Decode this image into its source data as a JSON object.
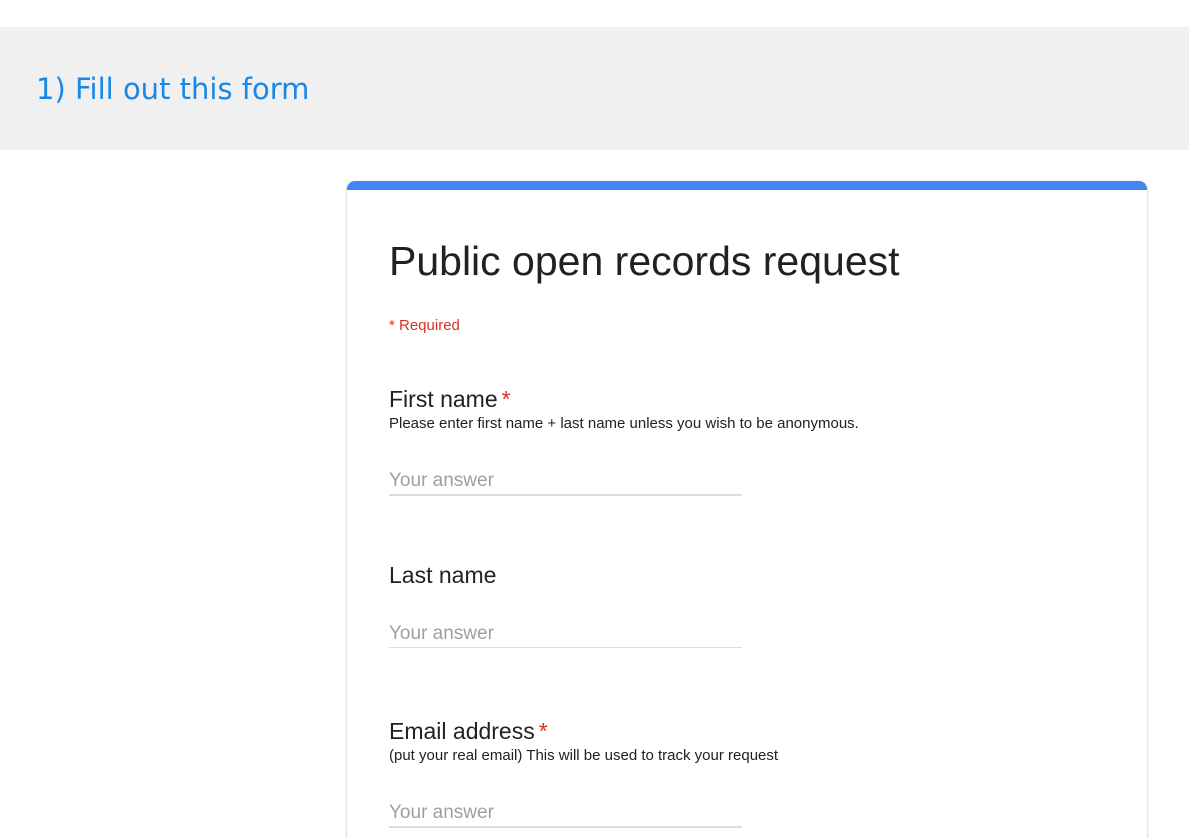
{
  "banner": {
    "title": "1) Fill out this form"
  },
  "form": {
    "title": "Public open records request",
    "required_note": "* Required",
    "questions": [
      {
        "label": "First name",
        "required_marker": "*",
        "help": "Please enter first name + last name unless you wish to be anonymous.",
        "placeholder": "Your answer"
      },
      {
        "label": "Last name",
        "required_marker": "",
        "help": "",
        "placeholder": "Your answer"
      },
      {
        "label": "Email address",
        "required_marker": "*",
        "help": "(put your real email) This will be used to track your request",
        "placeholder": "Your answer"
      }
    ]
  },
  "colors": {
    "banner_title": "#1a87e6",
    "banner_background": "#f0f0f0",
    "card_accent": "#4285f4",
    "required": "#d93025",
    "placeholder": "#9aa0a6"
  }
}
